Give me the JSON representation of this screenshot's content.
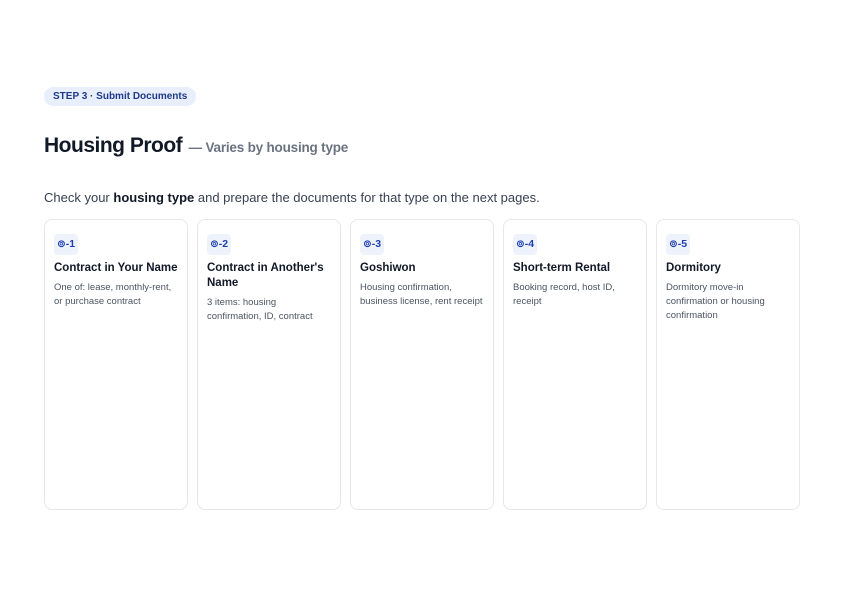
{
  "header": {
    "step_badge": "STEP 3 · Submit Documents",
    "title": "Housing Proof",
    "subtitle": "— Varies by housing type"
  },
  "intro": {
    "prefix": "Check your ",
    "emphasis": "housing type",
    "suffix": " and prepare the documents for that type on the next pages."
  },
  "cards": [
    {
      "tag": "⊚-1",
      "title": "Contract in Your Name",
      "description": "One of: lease, monthly-rent, or purchase contract"
    },
    {
      "tag": "⊚-2",
      "title": "Contract in Another's Name",
      "description": "3 items: housing confirmation, ID, contract"
    },
    {
      "tag": "⊚-3",
      "title": "Goshiwon",
      "description": "Housing confirmation, business license, rent receipt"
    },
    {
      "tag": "⊚-4",
      "title": "Short-term Rental",
      "description": "Booking record, host ID, receipt"
    },
    {
      "tag": "⊚-5",
      "title": "Dormitory",
      "description": "Dormitory move-in confirmation or housing confirmation"
    }
  ]
}
